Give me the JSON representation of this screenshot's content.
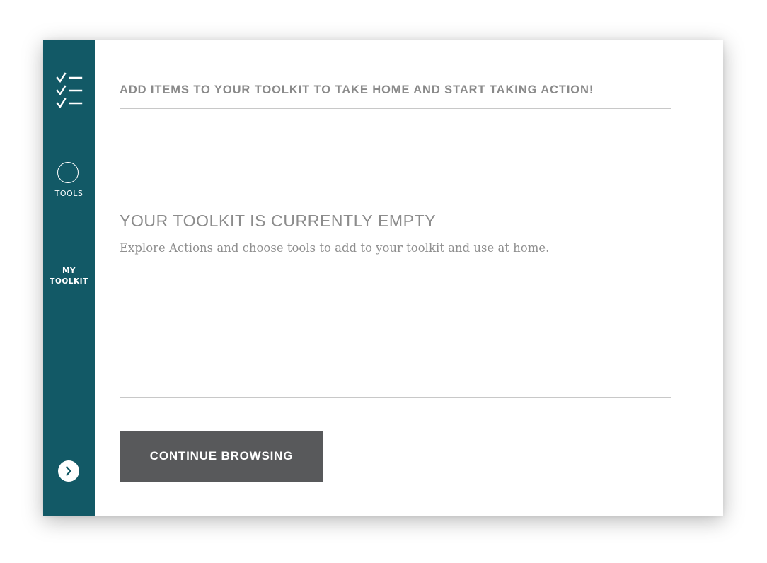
{
  "sidebar": {
    "checklist_icon": "checklist-icon",
    "tools": {
      "icon": "circle-icon",
      "label": "TOOLS"
    },
    "my_toolkit": {
      "label_line1": "MY",
      "label_line2": "TOOLKIT"
    },
    "expand_icon": "chevron-right-icon",
    "background_color": "#125966"
  },
  "main": {
    "header_title": "ADD ITEMS TO YOUR TOOLKIT TO TAKE HOME AND START TAKING ACTION!",
    "empty_title": "YOUR TOOLKIT IS CURRENTLY EMPTY",
    "empty_description": "Explore Actions and choose tools to add to your toolkit and use at home.",
    "continue_button_label": "CONTINUE BROWSING",
    "button_color": "#58595b"
  }
}
